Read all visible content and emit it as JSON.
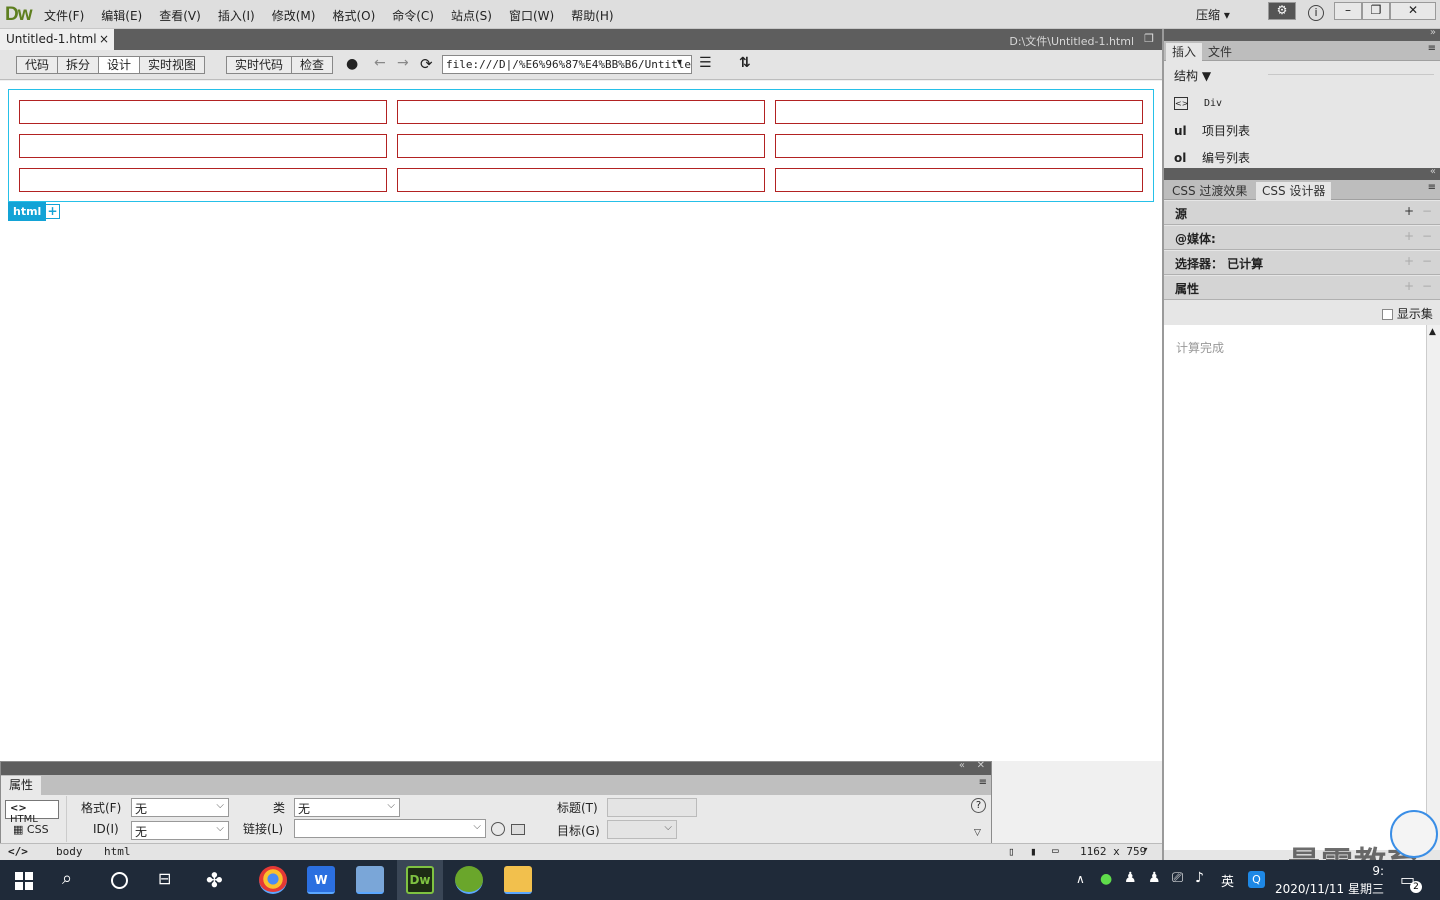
{
  "app": {
    "logo": "Dw",
    "compress_label": "压缩"
  },
  "menu": [
    "文件(F)",
    "编辑(E)",
    "查看(V)",
    "插入(I)",
    "修改(M)",
    "格式(O)",
    "命令(C)",
    "站点(S)",
    "窗口(W)",
    "帮助(H)"
  ],
  "document": {
    "tab_label": "Untitled-1.html",
    "close": "×",
    "path": "D:\\文件\\Untitled-1.html"
  },
  "toolbar": {
    "views": [
      "代码",
      "拆分",
      "设计",
      "实时视图"
    ],
    "active_view": "设计",
    "live": [
      "实时代码",
      "检查"
    ],
    "address": "file:///D|/%E6%96%87%E4%BB%B6/Untitled"
  },
  "canvas": {
    "rows": 3,
    "cols": 3,
    "tag_label": "html",
    "add_label": "+"
  },
  "insert_panel": {
    "tabs": [
      "插入",
      "文件"
    ],
    "category": "结构",
    "items": [
      {
        "icon": "div-icon",
        "label": "Div"
      },
      {
        "icon": "ul",
        "label": "项目列表"
      },
      {
        "icon": "ol",
        "label": "编号列表"
      }
    ]
  },
  "css_panel": {
    "tabs": [
      "CSS 过渡效果",
      "CSS 设计器"
    ],
    "sections": [
      "源",
      "@媒体:",
      "选择器： 已计算",
      "属性"
    ],
    "show_set_label": "显示集",
    "computed_text": "计算完成"
  },
  "properties": {
    "title": "属性",
    "html_btn": "HTML",
    "css_btn": "CSS",
    "format_label": "格式(F)",
    "format_value": "无",
    "id_label": "ID(I)",
    "id_value": "无",
    "class_label": "类",
    "class_value": "无",
    "link_label": "链接(L)",
    "title_label": "标题(T)",
    "target_label": "目标(G)"
  },
  "status": {
    "tags": [
      "body",
      "html"
    ],
    "size": "1162 x 759"
  },
  "taskbar": {
    "time": "9:",
    "date": "2020/11/11 星期三",
    "lang": "英",
    "notif_count": "2"
  },
  "watermark": "最需教育",
  "colors": {
    "cell_border": "#b22222",
    "table_border": "#26c0e8",
    "tag_bg": "#13a3d6",
    "logo": "#5e7f1f"
  }
}
